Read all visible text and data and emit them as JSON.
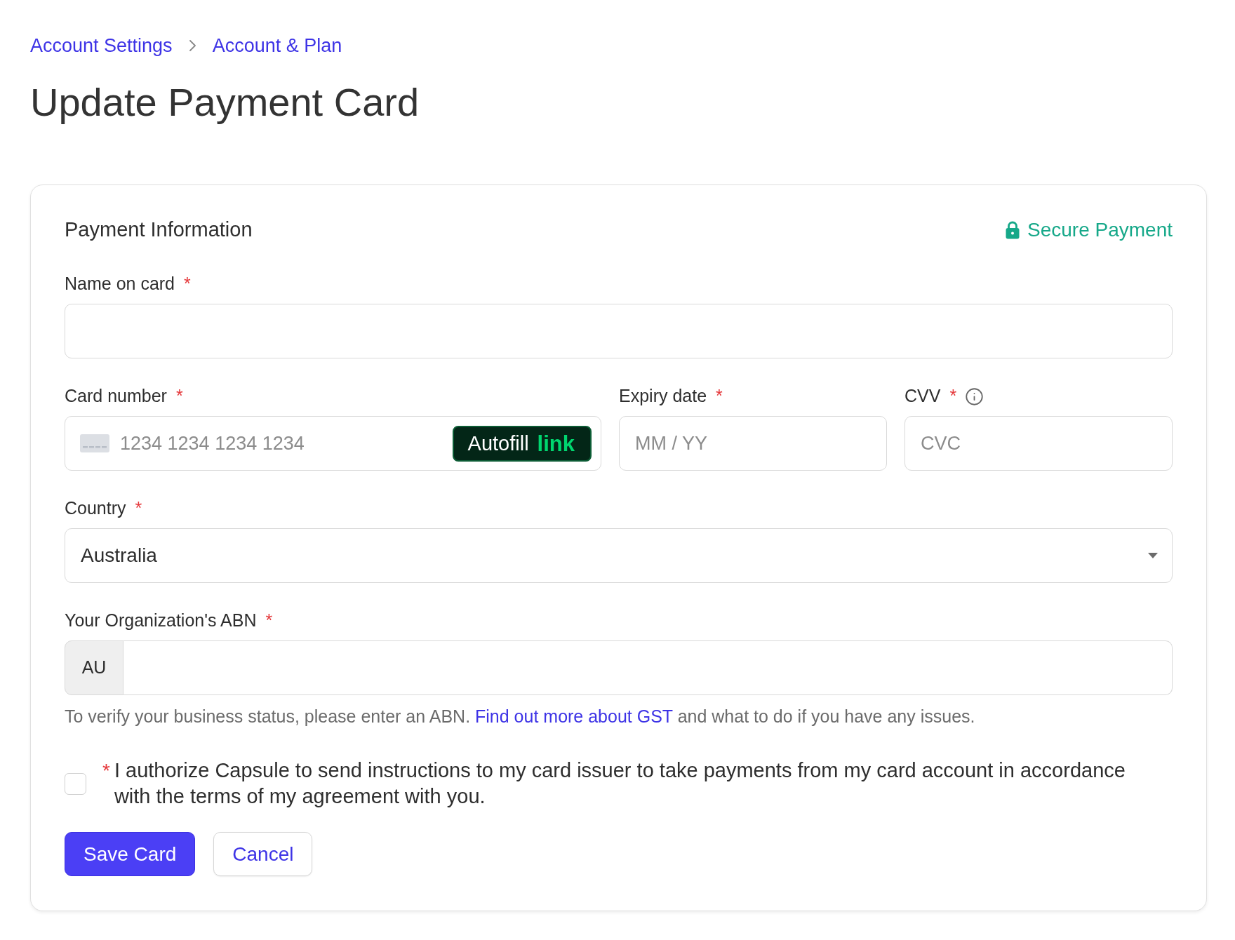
{
  "breadcrumb": [
    {
      "label": "Account Settings"
    },
    {
      "label": "Account & Plan"
    }
  ],
  "title": "Update Payment Card",
  "form": {
    "heading": "Payment Information",
    "secure_note": "Secure Payment",
    "rows": [
      [
        {
          "kind": "text",
          "label": "Name on card",
          "required_mark": "*"
        }
      ],
      [
        {
          "kind": "card_number",
          "label": "Card number",
          "required_mark": "*",
          "placeholder": "1234 1234 1234 1234",
          "autofill": {
            "label": "Autofill",
            "brand": "link"
          }
        },
        {
          "kind": "text",
          "label": "Expiry date",
          "required_mark": "*",
          "placeholder": "MM / YY"
        },
        {
          "kind": "text",
          "label": "CVV",
          "required_mark": "*",
          "info": true,
          "placeholder": "CVC"
        }
      ],
      [
        {
          "kind": "select",
          "label": "Country",
          "required_mark": "*",
          "value": "Australia"
        }
      ],
      [
        {
          "kind": "prefixed",
          "label": "Your Organization's ABN",
          "required_mark": "*",
          "prefix": "AU",
          "help": {
            "before": "To verify your business status, please enter an ABN.",
            "link": "Find out more about GST",
            "after": "and what to do if you have any issues."
          }
        }
      ]
    ],
    "consent": {
      "checked": false,
      "required_mark": "*",
      "text": "I authorize Capsule to send instructions to my card issuer to take payments from my card account in accordance with the terms of my agreement with you."
    },
    "buttons": [
      {
        "kind": "primary",
        "label": "Save Card"
      },
      {
        "kind": "secondary",
        "label": "Cancel"
      }
    ]
  }
}
